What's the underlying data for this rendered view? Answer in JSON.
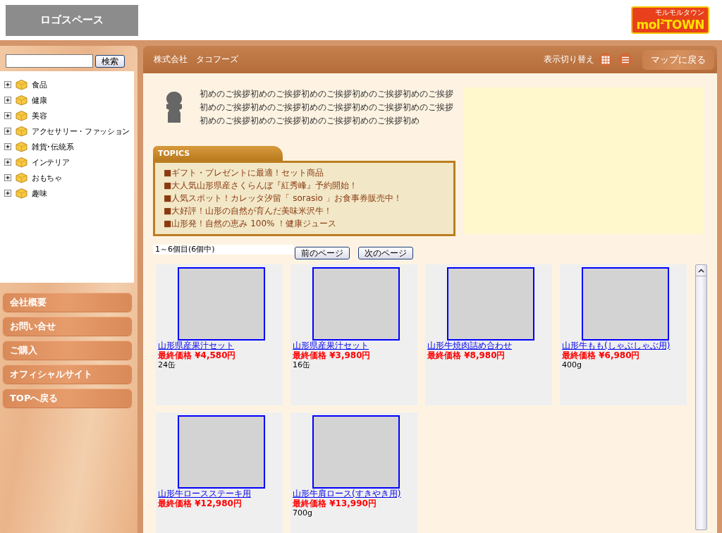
{
  "header": {
    "logo_placeholder": "ロゴスペース",
    "brand": {
      "name": "mol$^{2}$TOWN",
      "tagline": "モルモルタウン"
    }
  },
  "sidebar": {
    "search": {
      "button": "検索"
    },
    "categories": [
      {
        "label": "食品",
        "expanded": false
      },
      {
        "label": "健康",
        "expanded": false
      },
      {
        "label": "美容",
        "expanded": false
      },
      {
        "label": "アクセサリー・ファッション",
        "expanded": false
      },
      {
        "label": "雑貨･伝統系",
        "expanded": false
      },
      {
        "label": "インテリア",
        "expanded": false
      },
      {
        "label": "おもちゃ",
        "expanded": false
      },
      {
        "label": "趣味",
        "expanded": false
      }
    ],
    "nav": [
      "会社概要",
      "お問い合せ",
      "ご購入",
      "オフィシャルサイト",
      "TOPへ戻る"
    ]
  },
  "main": {
    "company": "株式会社　タコフーズ",
    "view_toggle": {
      "label": "表示切り替え",
      "modes": [
        {
          "kind": "grid"
        },
        {
          "kind": "list"
        }
      ]
    },
    "map_button": "マップに戻る",
    "greeting": "初めのご挨拶初めのご挨拶初めのご挨拶初めのご挨拶初めのご挨拶初めのご挨拶初めのご挨拶初めのご挨拶初めのご挨拶初めのご挨拶初めのご挨拶初めのご挨拶初めのご挨拶初めのご挨拶初め",
    "topics": {
      "title": "TOPICS",
      "items": [
        "■ギフト・プレゼントに最適！セット商品",
        "■大人気山形県産さくらんぼ『紅秀峰』予約開始！",
        "■人気スポット！カレッタ汐留「 sorasio 」お食事券販売中！",
        "■大好評！山形の自然が育んだ美味米沢牛！",
        "■山形発！自然の恵み 100% ！健康ジュース"
      ]
    },
    "pager": {
      "count": "1～6個目(6個中)",
      "prev": "前のページ",
      "next": "次のページ"
    },
    "products": [
      {
        "name": "山形県産果汁セット",
        "price": "最終価格 ¥4,580円",
        "note": "24缶"
      },
      {
        "name": "山形県産果汁セット",
        "price": "最終価格 ¥3,980円",
        "note": "16缶"
      },
      {
        "name": "山形牛焼肉詰め合わせ",
        "price": "最終価格 ¥8,980円"
      },
      {
        "name": "山形牛もも(しゃぶしゃぶ用)",
        "price": "最終価格 ¥6,980円",
        "note": "400g"
      },
      {
        "name": "山形牛ロースステーキ用",
        "price": "最終価格 ¥12,980円"
      },
      {
        "name": "山形牛肩ロース(すきやき用)",
        "price": "最終価格 ¥13,990円",
        "note": "700g"
      }
    ]
  }
}
